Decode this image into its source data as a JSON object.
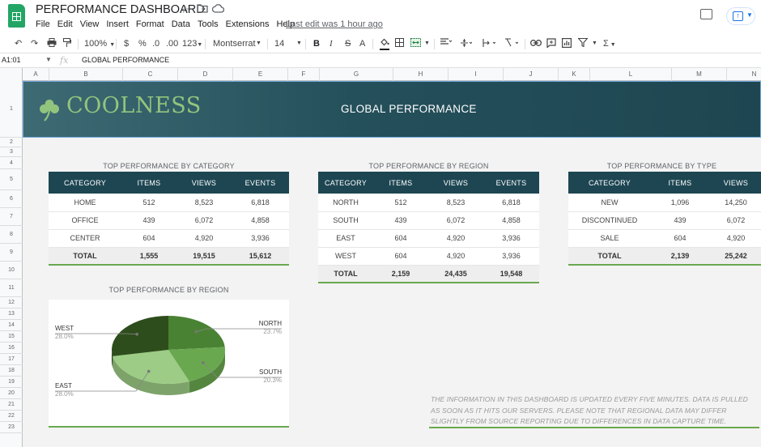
{
  "app": {
    "doc_title": "PERFORMANCE DASHBOARD",
    "menu": [
      "File",
      "Edit",
      "View",
      "Insert",
      "Format",
      "Data",
      "Tools",
      "Extensions",
      "Help"
    ],
    "last_edit": "Last edit was 1 hour ago"
  },
  "toolbar": {
    "zoom": "100%",
    "currency": "$",
    "percent": "%",
    "dec_less": ".0",
    "dec_more": ".00",
    "format_more": "123",
    "font": "Montserrat",
    "font_size": "14",
    "bold": "B",
    "italic": "I",
    "strike": "S",
    "text_color": "A",
    "sum": "Σ"
  },
  "formula_bar": {
    "cell_ref": "A1:01",
    "fx": "fx",
    "value": "GLOBAL PERFORMANCE"
  },
  "columns": [
    "A",
    "B",
    "C",
    "D",
    "E",
    "F",
    "G",
    "H",
    "I",
    "J",
    "K",
    "L",
    "M",
    "N"
  ],
  "rows": [
    "1",
    "2",
    "3",
    "4",
    "5",
    "6",
    "7",
    "8",
    "9",
    "10",
    "11",
    "12",
    "13",
    "14",
    "15",
    "16",
    "17",
    "18",
    "19",
    "20",
    "21",
    "22",
    "23"
  ],
  "banner": {
    "brand": "COOLNESS",
    "title": "GLOBAL PERFORMANCE"
  },
  "table_category": {
    "caption": "TOP PERFORMANCE BY CATEGORY",
    "headers": [
      "CATEGORY",
      "ITEMS",
      "VIEWS",
      "EVENTS"
    ],
    "rows": [
      [
        "HOME",
        "512",
        "8,523",
        "6,818"
      ],
      [
        "OFFICE",
        "439",
        "6,072",
        "4,858"
      ],
      [
        "CENTER",
        "604",
        "4,920",
        "3,936"
      ]
    ],
    "total": [
      "TOTAL",
      "1,555",
      "19,515",
      "15,612"
    ]
  },
  "table_region": {
    "caption": "TOP PERFORMANCE BY REGION",
    "headers": [
      "CATEGORY",
      "ITEMS",
      "VIEWS",
      "EVENTS"
    ],
    "rows": [
      [
        "NORTH",
        "512",
        "8,523",
        "6,818"
      ],
      [
        "SOUTH",
        "439",
        "6,072",
        "4,858"
      ],
      [
        "EAST",
        "604",
        "4,920",
        "3,936"
      ],
      [
        "WEST",
        "604",
        "4,920",
        "3,936"
      ]
    ],
    "total": [
      "TOTAL",
      "2,159",
      "24,435",
      "19,548"
    ]
  },
  "table_type": {
    "caption": "TOP PERFORMANCE BY TYPE",
    "headers": [
      "CATEGORY",
      "ITEMS",
      "VIEWS"
    ],
    "rows": [
      [
        "NEW",
        "1,096",
        "14,250"
      ],
      [
        "DISCONTINUED",
        "439",
        "6,072"
      ],
      [
        "SALE",
        "604",
        "4,920"
      ]
    ],
    "total": [
      "TOTAL",
      "2,139",
      "25,242"
    ]
  },
  "chart_data": {
    "type": "pie",
    "title": "TOP PERFORMANCE BY REGION",
    "categories": [
      "NORTH",
      "SOUTH",
      "EAST",
      "WEST"
    ],
    "values": [
      23.7,
      20.3,
      28.0,
      28.0
    ],
    "labels": [
      "23.7%",
      "20.3%",
      "28.0%",
      "28.0%"
    ],
    "colors": [
      "#4a8233",
      "#6aa84f",
      "#9ccc85",
      "#2e4d1c"
    ],
    "style": "3d"
  },
  "note": "THE INFORMATION IN THIS DASHBOARD IS UPDATED EVERY FIVE MINUTES. DATA IS PULLED AS SOON AS IT HITS OUR SERVERS. PLEASE NOTE THAT REGIONAL DATA MAY DIFFER SLIGHTLY FROM SOURCE REPORTING DUE TO DIFFERENCES IN DATA CAPTURE TIME.",
  "icons": [
    "sheets-logo",
    "star-icon",
    "move-folder-icon",
    "cloud-saved-icon",
    "comments-icon",
    "share-icon",
    "undo-icon",
    "redo-icon",
    "print-icon",
    "paint-format-icon",
    "fill-color-icon",
    "borders-icon",
    "merge-cells-icon",
    "align-icon",
    "valign-icon",
    "wrap-icon",
    "rotate-icon",
    "link-icon",
    "comment-icon",
    "chart-icon",
    "filter-icon",
    "functions-icon",
    "clover-icon"
  ]
}
